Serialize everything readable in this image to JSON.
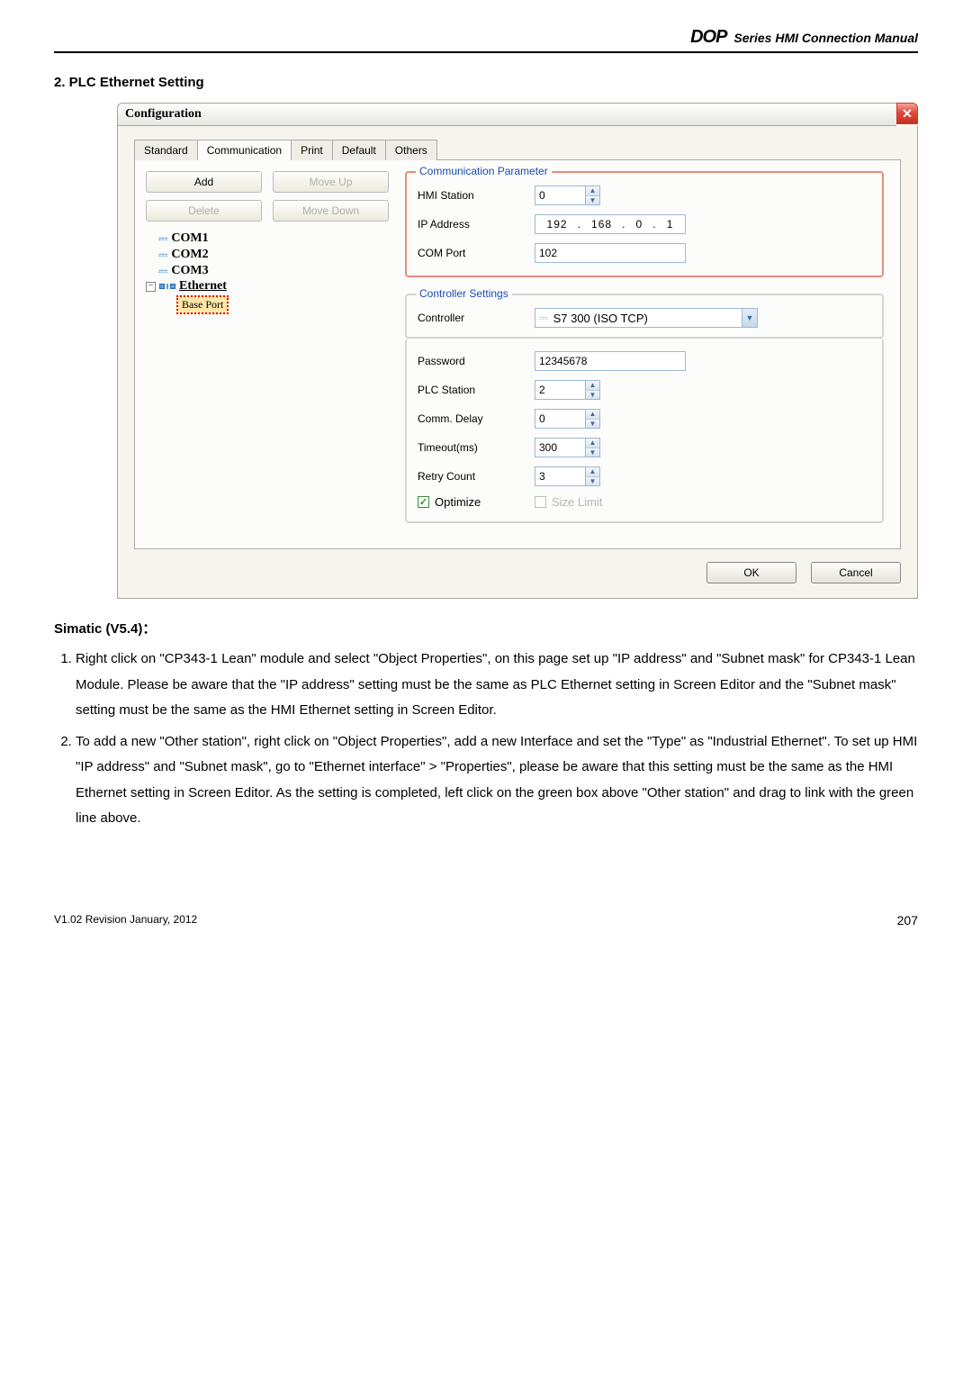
{
  "header": {
    "logo": "DOP",
    "subtitle": "Series HMI Connection Manual"
  },
  "section_title": "2.  PLC Ethernet Setting",
  "dialog": {
    "title": "Configuration",
    "close_glyph": "✕",
    "tabs": {
      "standard": "Standard",
      "communication": "Communication",
      "print": "Print",
      "default": "Default",
      "others": "Others"
    },
    "buttons": {
      "add": "Add",
      "moveup": "Move Up",
      "delete": "Delete",
      "movedown": "Move Down"
    },
    "tree": {
      "com1": "COM1",
      "com2": "COM2",
      "com3": "COM3",
      "ethernet": "Ethernet",
      "baseport": "Base Port"
    },
    "commparam": {
      "legend": "Communication Parameter",
      "hmi_station_lbl": "HMI Station",
      "hmi_station_val": "0",
      "ip_lbl": "IP Address",
      "ip1": "192",
      "ip2": "168",
      "ip3": "0",
      "ip4": "1",
      "com_port_lbl": "COM Port",
      "com_port_val": "102"
    },
    "ctrl": {
      "legend": "Controller Settings",
      "controller_lbl": "Controller",
      "controller_val": "S7 300 (ISO TCP)",
      "password_lbl": "Password",
      "password_val": "12345678",
      "plc_station_lbl": "PLC Station",
      "plc_station_val": "2",
      "comm_delay_lbl": "Comm. Delay",
      "comm_delay_val": "0",
      "timeout_lbl": "Timeout(ms)",
      "timeout_val": "300",
      "retry_lbl": "Retry Count",
      "retry_val": "3",
      "optimize_lbl": "Optimize",
      "sizelimit_lbl": "Size Limit"
    },
    "footer": {
      "ok": "OK",
      "cancel": "Cancel"
    }
  },
  "body": {
    "simatic_heading": "Simatic (V5.4)：",
    "li1": "Right click on \"CP343-1 Lean\" module and select \"Object Properties\", on this page set up \"IP address\" and \"Subnet mask\" for CP343-1 Lean Module.   Please be aware that the \"IP address\" setting must be the same as PLC Ethernet setting in Screen Editor and the \"Subnet mask\" setting must be the same as the HMI Ethernet setting in Screen Editor.",
    "li2": "To add a new \"Other station\", right click on \"Object Properties\", add a new Interface and set the \"Type\" as \"Industrial Ethernet\". To set up HMI \"IP address\" and \"Subnet mask\", go to \"Ethernet interface\" > \"Properties\", please be aware that this setting must be the same as the HMI Ethernet setting in Screen Editor. As the setting is completed, left click on the green box above \"Other station\" and drag to link with the green line above."
  },
  "footer": {
    "revision": "V1.02  Revision January, 2012",
    "page": "207"
  }
}
